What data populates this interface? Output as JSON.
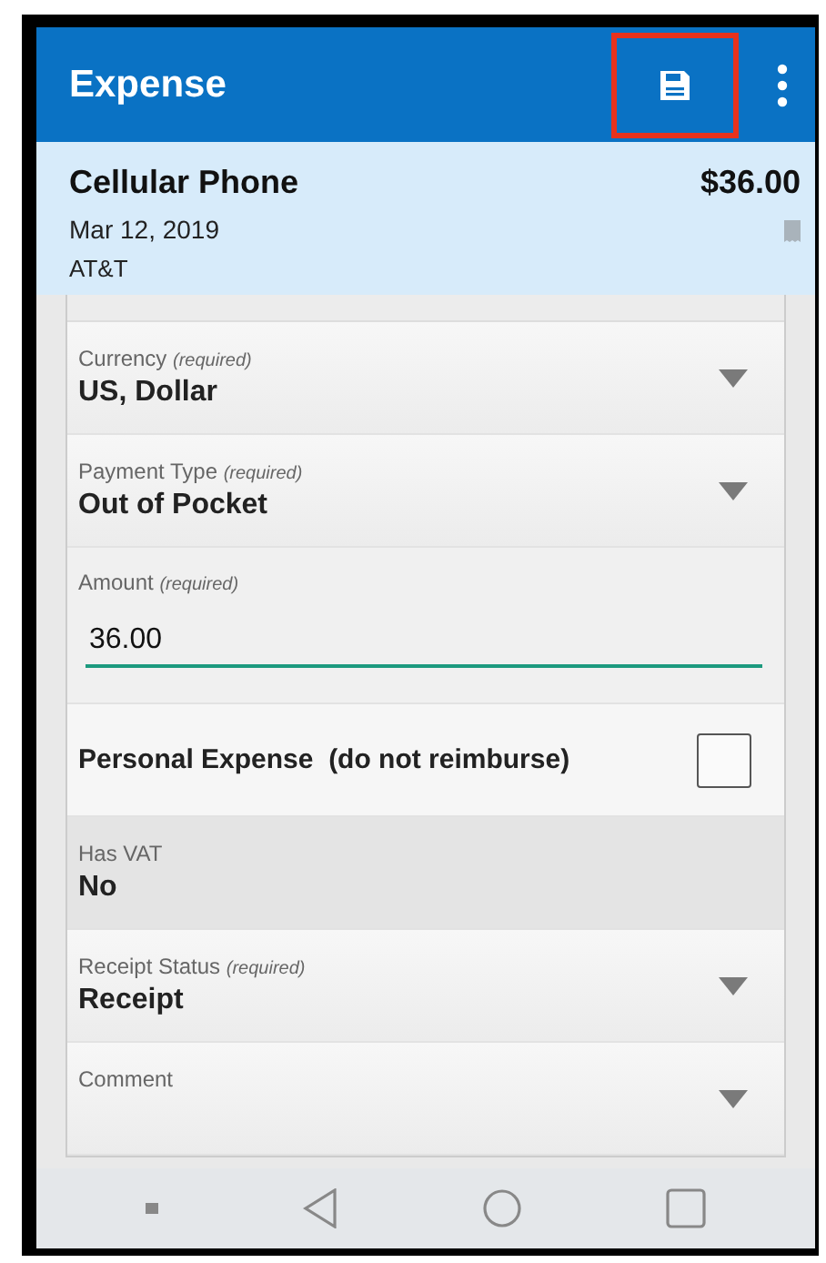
{
  "app_bar": {
    "title": "Expense",
    "save_highlighted": true
  },
  "summary": {
    "name": "Cellular Phone",
    "amount": "$36.00",
    "date": "Mar 12, 2019",
    "vendor": "AT&T"
  },
  "fields": [
    {
      "kind": "dropdown",
      "label": "Currency *(required)*",
      "value": "US, Dollar"
    },
    {
      "kind": "dropdown",
      "label": "Payment Type *(required)*",
      "value": "Out of Pocket"
    },
    {
      "kind": "input",
      "label": "Amount *(required)*",
      "value": "36.00"
    },
    {
      "kind": "checkbox",
      "label": "Personal Expense  (do not reimburse)",
      "checked": false
    },
    {
      "kind": "readonly",
      "label": "Has VAT",
      "value": "No"
    },
    {
      "kind": "dropdown",
      "label": "Receipt Status *(required)*",
      "value": "Receipt"
    },
    {
      "kind": "dropdown",
      "label": "Comment"
    }
  ]
}
